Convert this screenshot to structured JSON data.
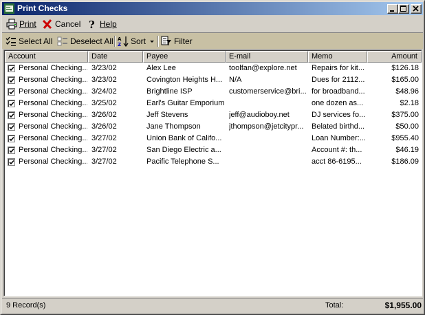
{
  "window": {
    "title": "Print Checks"
  },
  "menubar": {
    "print_label": "Print",
    "cancel_label": "Cancel",
    "help_label": "Help"
  },
  "toolbar": {
    "select_all_label": "Select All",
    "deselect_all_label": "Deselect All",
    "sort_label": "Sort",
    "filter_label": "Filter"
  },
  "table": {
    "columns": [
      "Account",
      "Date",
      "Payee",
      "E-mail",
      "Memo",
      "Amount"
    ],
    "rows": [
      {
        "checked": true,
        "account": "Personal Checking...",
        "date": "3/23/02",
        "payee": "Alex Lee",
        "email": "toolfan@explore.net",
        "memo": "Repairs for kit...",
        "amount": "$126.18"
      },
      {
        "checked": true,
        "account": "Personal Checking...",
        "date": "3/23/02",
        "payee": "Covington Heights H...",
        "email": "N/A",
        "memo": "Dues for 2112...",
        "amount": "$165.00"
      },
      {
        "checked": true,
        "account": "Personal Checking...",
        "date": "3/24/02",
        "payee": "Brightline ISP",
        "email": "customerservice@bri...",
        "memo": "for broadband...",
        "amount": "$48.96"
      },
      {
        "checked": true,
        "account": "Personal Checking...",
        "date": "3/25/02",
        "payee": "Earl's Guitar Emporium",
        "email": "",
        "memo": "one dozen as...",
        "amount": "$2.18"
      },
      {
        "checked": true,
        "account": "Personal Checking...",
        "date": "3/26/02",
        "payee": "Jeff Stevens",
        "email": "jeff@audioboy.net",
        "memo": "DJ services fo...",
        "amount": "$375.00"
      },
      {
        "checked": true,
        "account": "Personal Checking...",
        "date": "3/26/02",
        "payee": "Jane Thompson",
        "email": "jthompson@jetcitypr...",
        "memo": "Belated birthd...",
        "amount": "$50.00"
      },
      {
        "checked": true,
        "account": "Personal Checking...",
        "date": "3/27/02",
        "payee": "Union Bank of Califo...",
        "email": "",
        "memo": "Loan Number:...",
        "amount": "$955.40"
      },
      {
        "checked": true,
        "account": "Personal Checking...",
        "date": "3/27/02",
        "payee": "San Diego Electric a...",
        "email": "",
        "memo": "Account #: th...",
        "amount": "$46.19"
      },
      {
        "checked": true,
        "account": "Personal Checking...",
        "date": "3/27/02",
        "payee": "Pacific Telephone S...",
        "email": "",
        "memo": "acct 86-6195...",
        "amount": "$186.09"
      }
    ]
  },
  "status": {
    "record_count": "9 Record(s)",
    "total_label": "Total:",
    "total_value": "$1,955.00"
  },
  "icons": {
    "app": "print-checks-app-icon",
    "print": "printer-icon",
    "cancel": "red-x-icon",
    "help": "question-mark-icon",
    "select_all": "select-all-icon",
    "deselect_all": "deselect-all-icon",
    "sort": "sort-az-icon",
    "filter": "filter-icon"
  },
  "colors": {
    "titlebar_start": "#0a246a",
    "titlebar_end": "#a6caf0",
    "toolbar_bg": "#c8c0a4",
    "cancel_red": "#cc0000"
  }
}
